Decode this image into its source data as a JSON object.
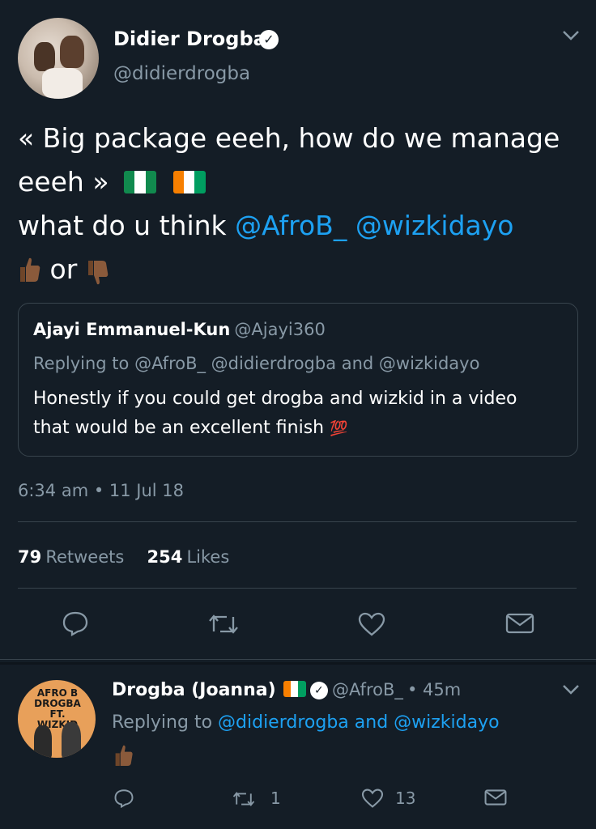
{
  "tweet": {
    "author_name": "Didier Drogba",
    "author_handle": "@didierdrogba",
    "text_line1": "« Big package eeeh, how do we manage",
    "text_line2": "eeeh »",
    "text_line3_prefix": "what do u think ",
    "mention1": "@AfroB_",
    "mention2": "@wizkidayo",
    "text_line4_mid": "or",
    "timestamp": "6:34 am • 11 Jul 18",
    "retweets_count": "79",
    "retweets_label": "Retweets",
    "likes_count": "254",
    "likes_label": "Likes"
  },
  "quoted": {
    "name": "Ajayi Emmanuel-Kun",
    "handle": "@Ajayi360",
    "replying_to": "Replying to @AfroB_ @didierdrogba and @wizkidayo",
    "text_line1": "Honestly if you could get drogba and wizkid in a video",
    "text_line2": "that would be an excellent finish",
    "emoji": "💯"
  },
  "reply": {
    "name": "Drogba (Joanna)",
    "handle": "@AfroB_",
    "time": "• 45m",
    "replying_prefix": "Replying to ",
    "replying_mentions": "@didierdrogba and @wizkidayo",
    "retweet_count": "1",
    "like_count": "13",
    "avatar_logo": "AFRO B DROGBA FT. WIZKID"
  },
  "icons": {
    "verified": "verified-badge-icon",
    "chevron": "chevron-down-icon",
    "reply": "reply-icon",
    "retweet": "retweet-icon",
    "like": "heart-icon",
    "dm": "envelope-icon",
    "thumbs_up": "thumbs-up-emoji",
    "thumbs_down": "thumbs-down-emoji"
  },
  "colors": {
    "background": "#141d26",
    "link": "#1da1f2",
    "muted": "#8899a6",
    "divider": "#38444d"
  }
}
